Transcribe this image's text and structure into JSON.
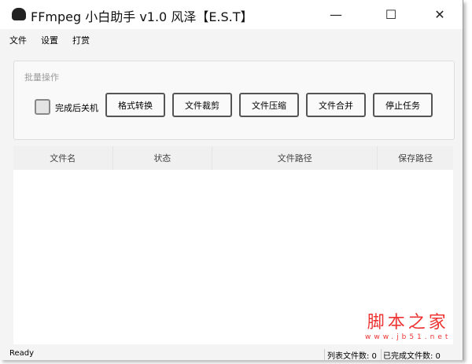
{
  "window": {
    "title": "FFmpeg 小白助手 v1.0 风泽【E.S.T】",
    "minimize": "—",
    "maximize": "☐",
    "close": "✕"
  },
  "menu": [
    "文件",
    "设置",
    "打赏"
  ],
  "batch": {
    "label": "批量操作",
    "shutdown_label": "完成后关机",
    "buttons": [
      "格式转换",
      "文件裁剪",
      "文件压缩",
      "文件合并",
      "停止任务"
    ]
  },
  "table": {
    "columns": [
      "文件名",
      "状态",
      "文件路径",
      "保存路径"
    ]
  },
  "status": {
    "text": "Ready",
    "list_count": "列表文件数: 0",
    "done_count": "已完成文件数: 0"
  },
  "watermark": {
    "name": "脚本之家",
    "url": "www.jb51.net"
  }
}
